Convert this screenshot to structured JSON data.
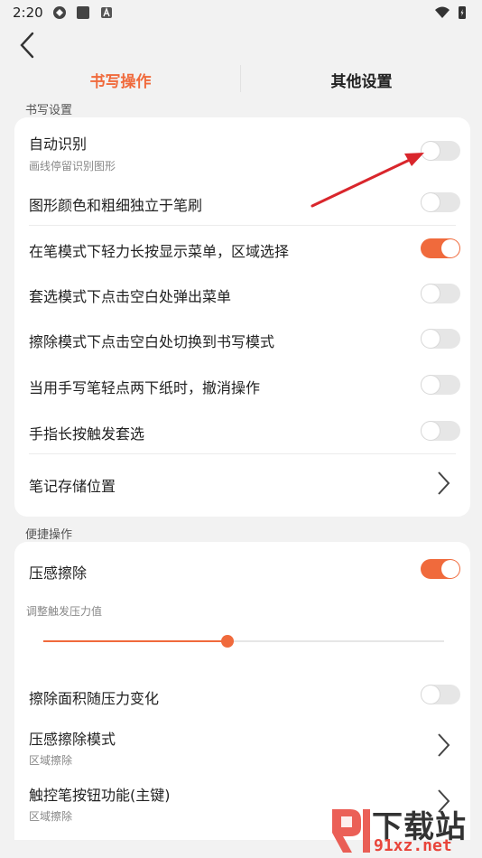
{
  "status_bar": {
    "time": "2:20"
  },
  "tabs": [
    {
      "label": "书写操作",
      "active": true
    },
    {
      "label": "其他设置",
      "active": false
    }
  ],
  "section1": {
    "title": "书写设置",
    "items": [
      {
        "label": "自动识别",
        "sub": "画线停留识别图形",
        "toggle": false
      },
      {
        "label": "图形颜色和粗细独立于笔刷",
        "toggle": false
      },
      {
        "label": "在笔模式下轻力长按显示菜单，区域选择",
        "toggle": true
      },
      {
        "label": "套选模式下点击空白处弹出菜单",
        "toggle": false
      },
      {
        "label": "擦除模式下点击空白处切换到书写模式",
        "toggle": false
      },
      {
        "label": "当用手写笔轻点两下纸时，撤消操作",
        "toggle": false
      },
      {
        "label": "手指长按触发套选",
        "toggle": false
      },
      {
        "label": "笔记存储位置"
      }
    ]
  },
  "section2": {
    "title": "便捷操作",
    "pressure_erase": {
      "label": "压感擦除",
      "toggle": true
    },
    "slider": {
      "label": "调整触发压力值",
      "value": 0.46
    },
    "area_pressure": {
      "label": "擦除面积随压力变化",
      "toggle": false
    },
    "erase_mode": {
      "label": "压感擦除模式",
      "sub": "区域擦除"
    },
    "pen_button": {
      "label": "触控笔按钮功能(主键)",
      "sub": "区域擦除"
    }
  },
  "watermark": {
    "top": "下载站",
    "bottom": "91xz.net"
  },
  "colors": {
    "accent": "#f06a3c",
    "annotation_arrow": "#d9262c"
  }
}
